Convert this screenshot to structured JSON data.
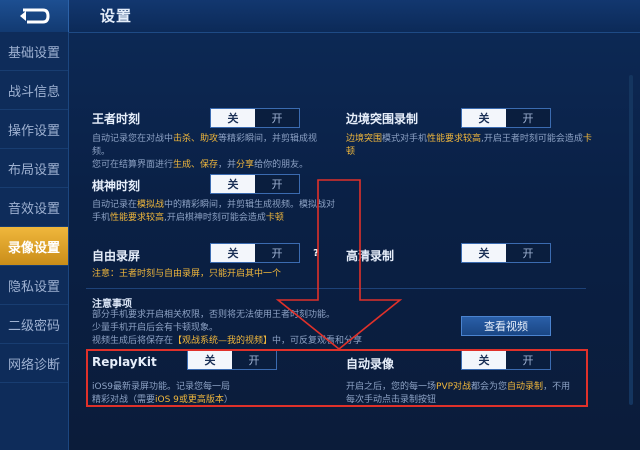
{
  "header": {
    "title": "设置",
    "back_icon": "back-arrow-icon"
  },
  "sidebar": {
    "items": [
      {
        "label": "基础设置"
      },
      {
        "label": "战斗信息"
      },
      {
        "label": "操作设置"
      },
      {
        "label": "布局设置"
      },
      {
        "label": "音效设置"
      },
      {
        "label": "录像设置"
      },
      {
        "label": "隐私设置"
      },
      {
        "label": "二级密码"
      },
      {
        "label": "网络诊断"
      }
    ],
    "active_index": 5
  },
  "settings": {
    "wangzhe": {
      "title": "王者时刻",
      "desc1_a": "自动记录您在对战中",
      "desc1_b": "击杀、助攻",
      "desc1_c": "等精彩瞬间，并剪辑成视频。",
      "desc2_a": "您可在结算界面进行",
      "desc2_b": "生成、保存",
      "desc2_c": "，并",
      "desc2_d": "分享",
      "desc2_e": "给你的朋友。",
      "on_label": "关",
      "off_label": "开"
    },
    "biaojing": {
      "title": "边境突围录制",
      "desc1_a": "边境突围",
      "desc1_b": "模式对手机",
      "desc1_c": "性能要求较高",
      "desc1_d": ",开启王者时刻可能会造成",
      "desc1_e": "卡",
      "desc2": "顿",
      "on_label": "关",
      "off_label": "开"
    },
    "qishen": {
      "title": "棋神时刻",
      "desc1_a": "自动记录在",
      "desc1_b": "模拟战",
      "desc1_c": "中的精彩瞬间，并剪辑生成视频。模拟战对",
      "desc2_a": "手机",
      "desc2_b": "性能要求较高",
      "desc2_c": ",开启棋神时刻可能会造成",
      "desc2_d": "卡顿",
      "on_label": "关",
      "off_label": "开"
    },
    "ziyou": {
      "title": "自由录屏",
      "help": "?",
      "note_a": "注意：王者时刻与自由录屏，",
      "note_b": "只能开启其中一个",
      "on_label": "关",
      "off_label": "开"
    },
    "gaoqing": {
      "title": "高清录制",
      "on_label": "关",
      "off_label": "开"
    },
    "notes": {
      "title": "注意事项",
      "line1": "部分手机要求开启相关权限，否则将无法使用王者时刻功能。",
      "line2": "少量手机开启后会有卡顿现象。",
      "line3_a": "视频生成后将保存在",
      "line3_b": "【观战系统—我的视频】",
      "line3_c": "中，可反复观看和分享",
      "view_button": "查看视频"
    },
    "replaykit": {
      "title": "ReplayKit",
      "desc1": "iOS9最新录屏功能。记录您每一局",
      "desc2_a": "精彩对战（需要",
      "desc2_b": "iOS 9或更高版本",
      "desc2_c": "）",
      "on_label": "关",
      "off_label": "开"
    },
    "zidong": {
      "title": "自动录像",
      "desc1_a": "开启之后，您的每一场",
      "desc1_b": "PVP对战",
      "desc1_c": "都会为您",
      "desc1_d": "自动录制",
      "desc1_e": "，不用",
      "desc2": "每次手动点击录制按钮",
      "on_label": "关",
      "off_label": "开"
    }
  },
  "colors": {
    "accent": "#f0b73c",
    "annotation": "#e0312a",
    "bg": "#0a2045"
  }
}
